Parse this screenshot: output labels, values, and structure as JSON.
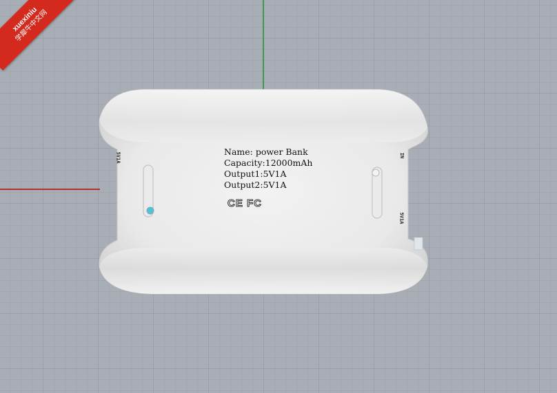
{
  "watermark": {
    "line1": "xuexiniu",
    "line2": "学犀牛中文网",
    "color": "#d42a1e"
  },
  "viewport": {
    "background": "#a9aeb6",
    "grid": true,
    "axes": {
      "x_color": "#b3302a",
      "y_color": "#3a9a4a"
    }
  },
  "product": {
    "label_lines": [
      "Name: power Bank",
      "Capacity:12000mAh",
      "Output1:5V1A",
      "Output2:5V1A"
    ],
    "certification": "CE FC",
    "left_port_label": "5V1A",
    "right_port_label_top": "IN",
    "right_port_label_bottom": "5V1A",
    "indicator_color": "#4fc3d6"
  }
}
